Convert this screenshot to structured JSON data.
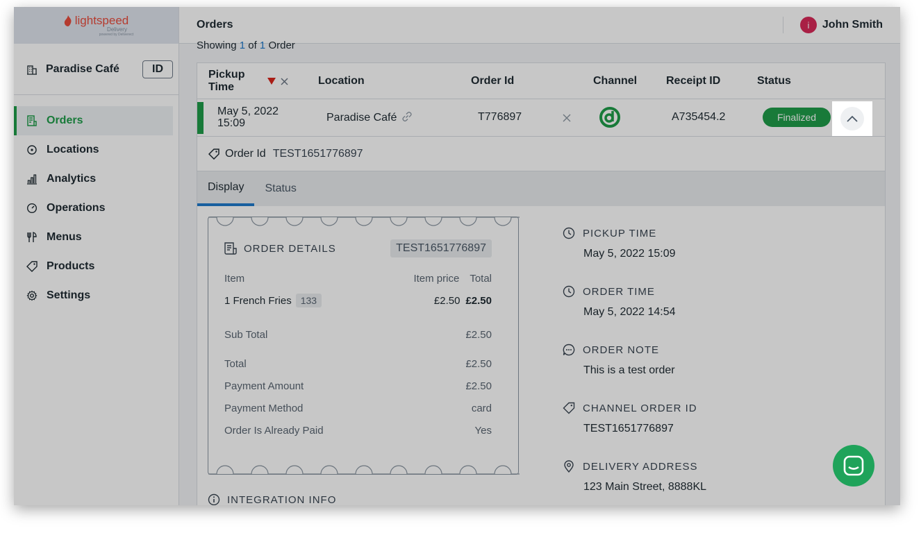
{
  "brand": {
    "name": "lightspeed",
    "sub": "Delivery",
    "sub2": "powered by Deliverect"
  },
  "sidebar": {
    "store": "Paradise Café",
    "id_button": "ID",
    "items": [
      {
        "label": "Orders",
        "icon": "orders-icon",
        "active": true
      },
      {
        "label": "Locations",
        "icon": "location-icon"
      },
      {
        "label": "Analytics",
        "icon": "analytics-icon"
      },
      {
        "label": "Operations",
        "icon": "operations-icon"
      },
      {
        "label": "Menus",
        "icon": "menus-icon"
      },
      {
        "label": "Products",
        "icon": "tag-icon"
      },
      {
        "label": "Settings",
        "icon": "gear-icon"
      }
    ]
  },
  "header": {
    "title": "Orders",
    "avatar_initial": "i",
    "user": "John Smith"
  },
  "list": {
    "showing_prefix": "Showing",
    "current": "1",
    "of": "of",
    "total": "1",
    "suffix": "Order"
  },
  "table": {
    "headers": {
      "pickup_time": "Pickup Time",
      "location": "Location",
      "order_id": "Order Id",
      "channel": "Channel",
      "receipt_id": "Receipt ID",
      "status": "Status"
    },
    "row": {
      "pickup_time": "May 5, 2022 15:09",
      "location": "Paradise Café",
      "order_id": "T776897",
      "receipt_id": "A735454.2",
      "status": "Finalized"
    }
  },
  "detail": {
    "order_id_label": "Order Id",
    "order_id_value": "TEST1651776897",
    "tabs": [
      "Display",
      "Status"
    ],
    "receipt": {
      "title": "ORDER DETAILS",
      "id": "TEST1651776897",
      "col_item": "Item",
      "col_price": "Item price",
      "col_total": "Total",
      "item": {
        "qty_name": "1 French Fries",
        "code": "133",
        "price": "£2.50",
        "total": "£2.50"
      },
      "subtotal_label": "Sub Total",
      "subtotal": "£2.50",
      "total_label": "Total",
      "total": "£2.50",
      "payment_amount_label": "Payment Amount",
      "payment_amount": "£2.50",
      "payment_method_label": "Payment Method",
      "payment_method": "card",
      "paid_label": "Order Is Already Paid",
      "paid": "Yes"
    },
    "info": [
      {
        "label": "PICKUP TIME",
        "value": "May 5, 2022 15:09",
        "icon": "clock-icon"
      },
      {
        "label": "ORDER TIME",
        "value": "May 5, 2022 14:54",
        "icon": "clock-icon"
      },
      {
        "label": "ORDER NOTE",
        "value": "This is a test order",
        "icon": "chat-bubble-icon"
      },
      {
        "label": "CHANNEL ORDER ID",
        "value": "TEST1651776897",
        "icon": "tag-icon"
      },
      {
        "label": "DELIVERY ADDRESS",
        "value": "123 Main Street, 8888KL",
        "icon": "pin-icon"
      }
    ],
    "integration_label": "INTEGRATION INFO"
  },
  "colors": {
    "accent": "#1f9d4a",
    "link": "#1f7acc",
    "avatar": "#d92a59",
    "brand": "#e84c3d"
  }
}
